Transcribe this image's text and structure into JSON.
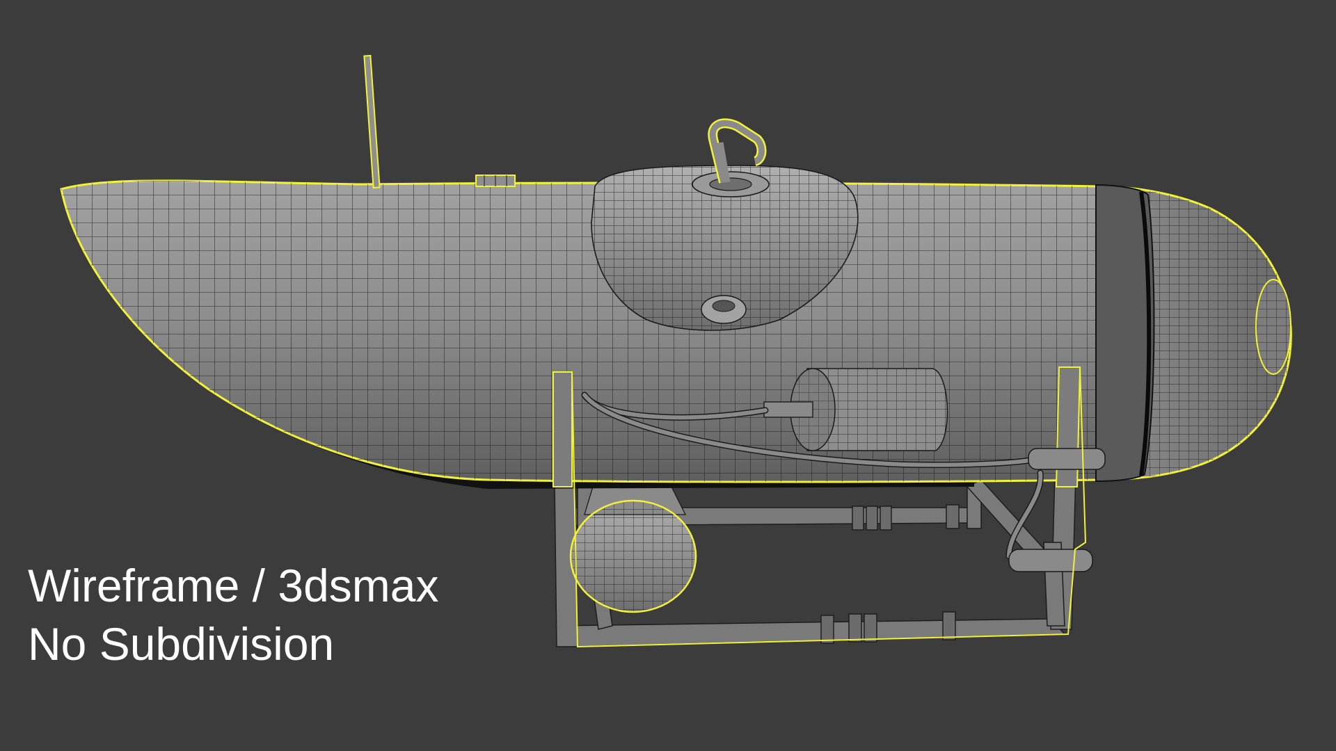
{
  "viewport": {
    "background_color": "#3c3c3c",
    "selection_outline_color": "#f2f23a",
    "wire_color": "#1a1a1a",
    "surface_color": "#8a8a8a"
  },
  "caption": {
    "line1": "Wireframe / 3dsmax",
    "line2": "No Subdivision"
  }
}
